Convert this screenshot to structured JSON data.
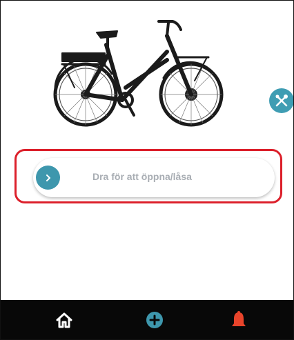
{
  "slider": {
    "label": "Dra för att öppna/låsa"
  },
  "icons": {
    "bike": "e-bike-image",
    "tools": "tools-icon",
    "handle": "chevron-right-icon",
    "home": "home-icon",
    "add": "add-circle-icon",
    "alert": "bell-icon"
  },
  "colors": {
    "accent": "#3e97ad",
    "highlight": "#dc1f2a",
    "nav_background": "#080808",
    "alert": "#e8442b"
  }
}
